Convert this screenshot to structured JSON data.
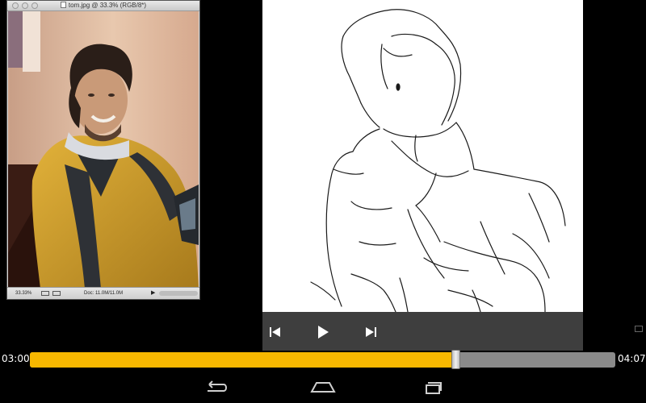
{
  "window": {
    "title": "tom.jpg @ 33.3% (RGB/8*)",
    "zoom": "33.33%",
    "doc_size": "Doc: 11.0M/11.0M"
  },
  "player": {
    "current_time": "03:00",
    "total_time": "04:07",
    "progress": 0.727
  },
  "colors": {
    "progress_fill": "#f7b800",
    "track": "#8a8a8a",
    "controls_bg": "#3e3e3e"
  },
  "icons": {
    "prev": "skip-previous-icon",
    "play": "play-icon",
    "next": "skip-next-icon",
    "back": "back-icon",
    "home": "home-icon",
    "recent": "recent-apps-icon"
  }
}
